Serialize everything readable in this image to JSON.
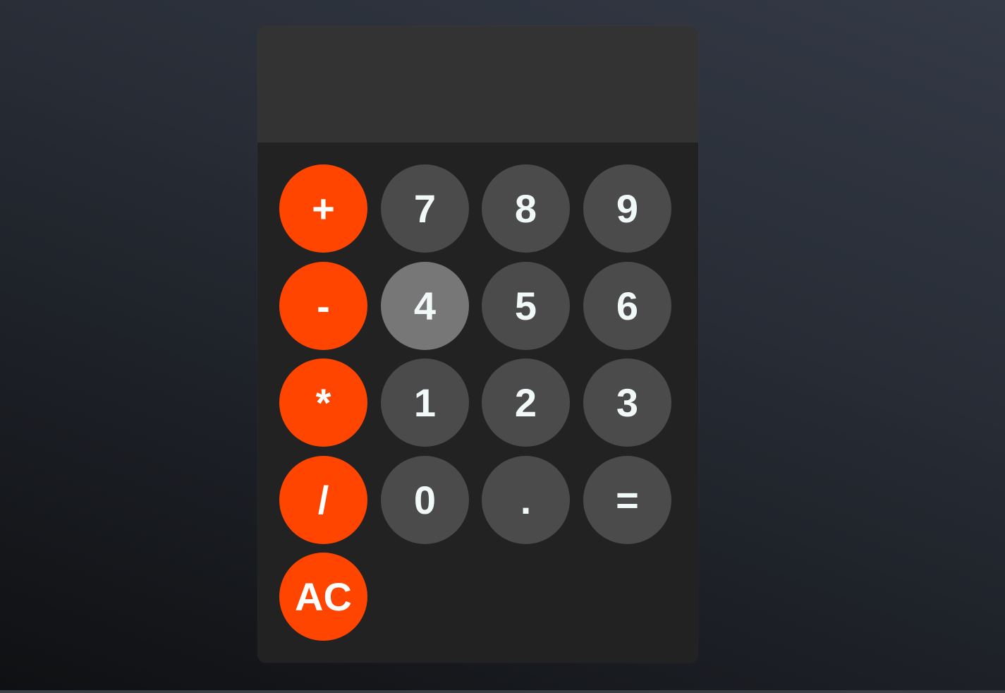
{
  "display": {
    "value": ""
  },
  "keys": {
    "plus": "+",
    "minus": "-",
    "multiply": "*",
    "divide": "/",
    "clear": "AC",
    "seven": "7",
    "eight": "8",
    "nine": "9",
    "four": "4",
    "five": "5",
    "six": "6",
    "one": "1",
    "two": "2",
    "three": "3",
    "zero": "0",
    "decimal": ".",
    "equals": "="
  },
  "colors": {
    "operator": "#ff4500",
    "number": "#4b4b4b",
    "number_active": "#777777",
    "display_bg": "#333333",
    "keypad_bg": "#222222",
    "key_text": "#f1f8f8"
  }
}
